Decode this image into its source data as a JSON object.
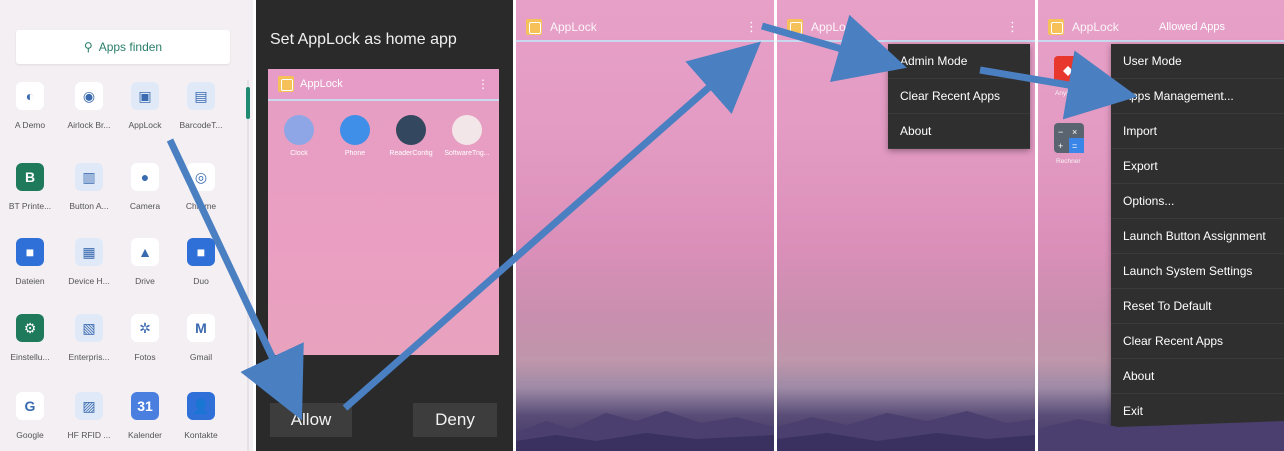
{
  "drawer": {
    "search_label": "Apps finden",
    "apps": [
      {
        "label": "A Demo",
        "color": "#ffffff",
        "glyph": "◐"
      },
      {
        "label": "Airlock Br...",
        "color": "#ffffff",
        "glyph": "◉"
      },
      {
        "label": "AppLock",
        "color": "#dfe9f7",
        "glyph": "▣"
      },
      {
        "label": "BarcodeT...",
        "color": "#dfe9f7",
        "glyph": "▤"
      },
      {
        "label": "BT Printe...",
        "color": "#1f7a5c",
        "glyph": "B"
      },
      {
        "label": "Button A...",
        "color": "#dfe9f7",
        "glyph": "▥"
      },
      {
        "label": "Camera",
        "color": "#ffffff",
        "glyph": "●"
      },
      {
        "label": "Chrome",
        "color": "#ffffff",
        "glyph": "◎"
      },
      {
        "label": "Dateien",
        "color": "#2f6fd8",
        "glyph": "■"
      },
      {
        "label": "Device H...",
        "color": "#dfe9f7",
        "glyph": "▦"
      },
      {
        "label": "Drive",
        "color": "#ffffff",
        "glyph": "▲"
      },
      {
        "label": "Duo",
        "color": "#2f6fd8",
        "glyph": "■"
      },
      {
        "label": "Einstellu...",
        "color": "#1f7a5c",
        "glyph": "⚙"
      },
      {
        "label": "Enterpris...",
        "color": "#dfe9f7",
        "glyph": "▧"
      },
      {
        "label": "Fotos",
        "color": "#ffffff",
        "glyph": "✲"
      },
      {
        "label": "Gmail",
        "color": "#ffffff",
        "glyph": "M"
      },
      {
        "label": "Google",
        "color": "#ffffff",
        "glyph": "G"
      },
      {
        "label": "HF RFID ...",
        "color": "#dfe9f7",
        "glyph": "▨"
      },
      {
        "label": "Kalender",
        "color": "#4a7fe0",
        "glyph": "31"
      },
      {
        "label": "Kontakte",
        "color": "#2f6fd8",
        "glyph": "👤"
      }
    ]
  },
  "dialog": {
    "title": "Set AppLock as home app",
    "preview_title": "AppLock",
    "preview_apps": [
      {
        "label": "Clock",
        "color": "#8fa6e6"
      },
      {
        "label": "Phone",
        "color": "#3f8fe8"
      },
      {
        "label": "ReaderConfig",
        "color": "#33485e"
      },
      {
        "label": "SoftwareTrig...",
        "color": "#f2e6e8"
      }
    ],
    "allow_label": "Allow",
    "deny_label": "Deny"
  },
  "screen3": {
    "title": "AppLock"
  },
  "screen4": {
    "title": "AppLock",
    "menu": [
      "Admin Mode",
      "Clear Recent Apps",
      "About"
    ]
  },
  "screen5": {
    "title": "AppLock",
    "subtitle": "Allowed Apps",
    "side_apps": [
      {
        "label": "AnyDesk",
        "color": "#e8382e"
      },
      {
        "label": "Rechner",
        "color": "#5a6470"
      }
    ],
    "menu": [
      "User Mode",
      "Apps Management...",
      "Import",
      "Export",
      "Options...",
      "Launch Button Assignment",
      "Launch System Settings",
      "Reset To Default",
      "Clear Recent Apps",
      "About",
      "Exit"
    ]
  },
  "colors": {
    "arrow": "#4a7fc1",
    "menu_bg": "#2f2f2f",
    "sky_top": "#e7a0c7",
    "drawer_bg": "#f3eff3",
    "dialog_bg": "#2a2a2a"
  }
}
